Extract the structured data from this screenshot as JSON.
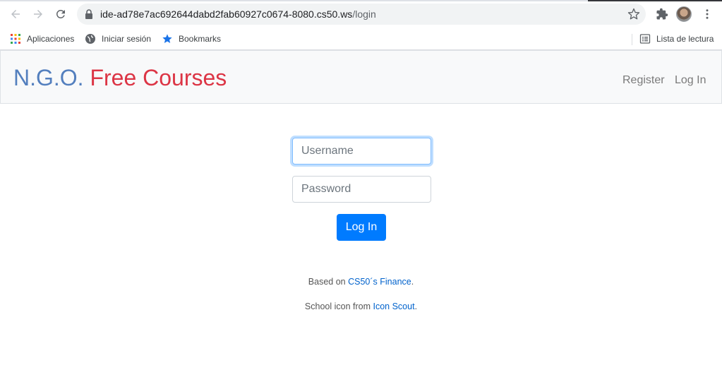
{
  "browser": {
    "url_host": "ide-ad78e7ac692644dabd2fab60927c0674-8080.cs50.ws",
    "url_path": "/login",
    "bookmarks": [
      {
        "label": "Aplicaciones",
        "icon": "apps-grid-icon"
      },
      {
        "label": "Iniciar sesión",
        "icon": "globe-icon"
      },
      {
        "label": "Bookmarks",
        "icon": "star-bookmark-icon"
      }
    ],
    "reading_list": "Lista de lectura"
  },
  "navbar": {
    "brand_part1": "N.G.O.",
    "brand_part2": "Free Courses",
    "links": [
      "Register",
      "Log In"
    ]
  },
  "form": {
    "username_placeholder": "Username",
    "password_placeholder": "Password",
    "submit_label": "Log In"
  },
  "footer": {
    "line1_prefix": "Based on ",
    "line1_link": "CS50´s Finance",
    "line1_suffix": ".",
    "line2_prefix": "School icon from ",
    "line2_link": "Icon Scout",
    "line2_suffix": "."
  },
  "colors": {
    "brand_blue": "#537fbe",
    "brand_red": "#dc3545",
    "primary": "#007bff",
    "link": "#0062cc"
  }
}
